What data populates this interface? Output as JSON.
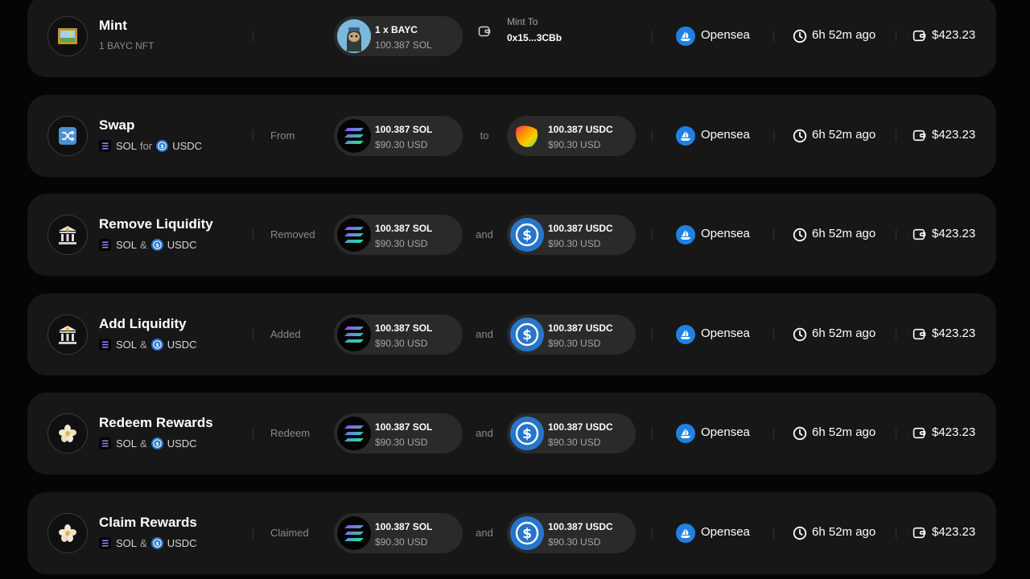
{
  "rows": [
    {
      "title": "Mint",
      "subtitle": "1 BAYC NFT",
      "asset": {
        "amount": "1 x BAYC",
        "value": "100.387 SOL"
      },
      "mint_to_label": "Mint To",
      "mint_to_address": "0x15...3CBb",
      "marketplace": "Opensea",
      "time": "6h 52m ago",
      "value": "$423.23"
    },
    {
      "title": "Swap",
      "subtitle": {
        "token_a": "SOL",
        "sep": "for",
        "token_b": "USDC"
      },
      "action": "From",
      "from": {
        "amount": "100.387 SOL",
        "value": "$90.30 USD"
      },
      "connector": "to",
      "to": {
        "amount": "100.387 USDC",
        "value": "$90.30 USD"
      },
      "marketplace": "Opensea",
      "time": "6h 52m ago",
      "value": "$423.23"
    },
    {
      "title": "Remove Liquidity",
      "subtitle": {
        "token_a": "SOL",
        "sep": "&",
        "token_b": "USDC"
      },
      "action": "Removed",
      "from": {
        "amount": "100.387 SOL",
        "value": "$90.30 USD"
      },
      "connector": "and",
      "to": {
        "amount": "100.387 USDC",
        "value": "$90.30 USD"
      },
      "marketplace": "Opensea",
      "time": "6h 52m ago",
      "value": "$423.23"
    },
    {
      "title": "Add Liquidity",
      "subtitle": {
        "token_a": "SOL",
        "sep": "&",
        "token_b": "USDC"
      },
      "action": "Added",
      "from": {
        "amount": "100.387 SOL",
        "value": "$90.30 USD"
      },
      "connector": "and",
      "to": {
        "amount": "100.387 USDC",
        "value": "$90.30 USD"
      },
      "marketplace": "Opensea",
      "time": "6h 52m ago",
      "value": "$423.23"
    },
    {
      "title": "Redeem Rewards",
      "subtitle": {
        "token_a": "SOL",
        "sep": "&",
        "token_b": "USDC"
      },
      "action": "Redeem",
      "from": {
        "amount": "100.387 SOL",
        "value": "$90.30 USD"
      },
      "connector": "and",
      "to": {
        "amount": "100.387 USDC",
        "value": "$90.30 USD"
      },
      "marketplace": "Opensea",
      "time": "6h 52m ago",
      "value": "$423.23"
    },
    {
      "title": "Claim Rewards",
      "subtitle": {
        "token_a": "SOL",
        "sep": "&",
        "token_b": "USDC"
      },
      "action": "Claimed",
      "from": {
        "amount": "100.387 SOL",
        "value": "$90.30 USD"
      },
      "connector": "and",
      "to": {
        "amount": "100.387 USDC",
        "value": "$90.30 USD"
      },
      "marketplace": "Opensea",
      "time": "6h 52m ago",
      "value": "$423.23"
    }
  ],
  "icons": {
    "type_icons": [
      "picture-frame-icon",
      "shuffle-icon",
      "bank-icon",
      "bank-icon",
      "flower-icon",
      "flower-icon"
    ],
    "marketplace_icon": "opensea-icon",
    "time_icon": "clock-icon",
    "value_icon": "wallet-icon"
  },
  "colors": {
    "background": "#050505",
    "card": "#171717",
    "pill": "#2a2a2a",
    "muted_text": "#8a8a8a",
    "opensea_blue": "#2081e2",
    "usdc_blue": "#2775ca"
  }
}
